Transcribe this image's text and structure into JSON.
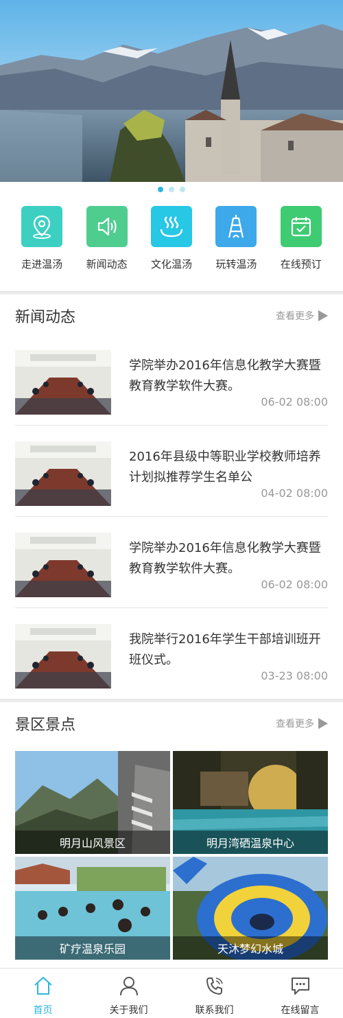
{
  "banner": {
    "slides": 3,
    "active_slide": 1
  },
  "quick_nav": [
    {
      "label": "走进温汤",
      "icon": "location-pin-icon",
      "color": "#3dd0c2"
    },
    {
      "label": "新闻动态",
      "icon": "speaker-icon",
      "color": "#4fcd8f"
    },
    {
      "label": "文化温汤",
      "icon": "hot-spring-icon",
      "color": "#27c7e6"
    },
    {
      "label": "玩转温汤",
      "icon": "tower-icon",
      "color": "#3da9ea"
    },
    {
      "label": "在线预订",
      "icon": "calendar-check-icon",
      "color": "#3ecb72"
    }
  ],
  "news_section": {
    "title": "新闻动态",
    "more_label": "查看更多",
    "items": [
      {
        "title": "学院举办2016年信息化教学大赛暨教育教学软件大赛。",
        "date": "06-02 08:00"
      },
      {
        "title": "2016年县级中等职业学校教师培养计划拟推荐学生名单公",
        "date": "04-02 08:00"
      },
      {
        "title": "学院举办2016年信息化教学大赛暨教育教学软件大赛。",
        "date": "06-02 08:00"
      },
      {
        "title": "我院举行2016年学生干部培训班开班仪式。",
        "date": "03-23 08:00"
      }
    ]
  },
  "scenic_section": {
    "title": "景区景点",
    "more_label": "查看更多",
    "items": [
      {
        "caption": "明月山风景区"
      },
      {
        "caption": "明月湾硒温泉中心"
      },
      {
        "caption": "矿疗温泉乐园"
      },
      {
        "caption": "天沐梦幻水城"
      }
    ]
  },
  "tab_bar": [
    {
      "label": "首页",
      "icon": "home-icon",
      "active": true
    },
    {
      "label": "关于我们",
      "icon": "person-icon",
      "active": false
    },
    {
      "label": "联系我们",
      "icon": "phone-icon",
      "active": false
    },
    {
      "label": "在线留言",
      "icon": "message-icon",
      "active": false
    }
  ],
  "colors": {
    "accent": "#2bb6e0",
    "text": "#333333",
    "muted": "#999999"
  }
}
